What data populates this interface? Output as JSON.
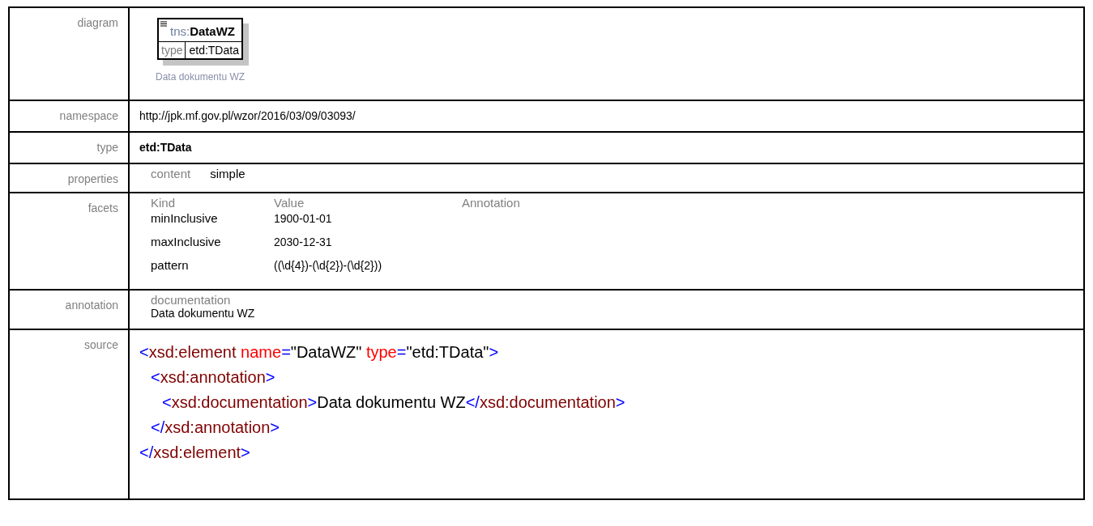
{
  "diagram": {
    "prefix": "tns:",
    "name": "DataWZ",
    "type_label": "type",
    "type_value": "etd:TData",
    "caption": "Data dokumentu WZ"
  },
  "rows": [
    {
      "label": "diagram",
      "kind": "diagram"
    },
    {
      "label": "namespace",
      "kind": "text",
      "value": "http://jpk.mf.gov.pl/wzor/2016/03/09/03093/"
    },
    {
      "label": "type",
      "kind": "bold",
      "value": "etd:TData"
    },
    {
      "label": "properties",
      "kind": "properties"
    },
    {
      "label": "facets",
      "kind": "facets"
    },
    {
      "label": "annotation",
      "kind": "annotation"
    },
    {
      "label": "source",
      "kind": "source"
    }
  ],
  "properties": [
    {
      "name": "content",
      "value": "simple"
    }
  ],
  "facets": {
    "columns": [
      "Kind",
      "Value",
      "Annotation"
    ],
    "rows": [
      {
        "kind": "minInclusive",
        "value": "1900-01-01"
      },
      {
        "kind": "maxInclusive",
        "value": "2030-12-31"
      },
      {
        "kind": "pattern",
        "value": "((\\d{4})-(\\d{2})-(\\d{2}))"
      }
    ]
  },
  "annotation": {
    "label": "documentation",
    "text": "Data dokumentu WZ"
  },
  "source": {
    "lines": [
      {
        "tokens": [
          {
            "kind": "punct",
            "text": "<"
          },
          {
            "kind": "tag",
            "text": "xsd:element"
          },
          {
            "kind": "attr",
            "text": " name"
          },
          {
            "kind": "punct",
            "text": "="
          },
          {
            "kind": "text",
            "text": "\"DataWZ\""
          },
          {
            "kind": "attr",
            "text": " type"
          },
          {
            "kind": "punct",
            "text": "="
          },
          {
            "kind": "text",
            "text": "\"etd:TData\""
          },
          {
            "kind": "punct",
            "text": ">"
          }
        ],
        "children": [
          {
            "tokens": [
              {
                "kind": "punct",
                "text": "<"
              },
              {
                "kind": "tag",
                "text": "xsd:annotation"
              },
              {
                "kind": "punct",
                "text": ">"
              }
            ],
            "children": [
              {
                "tokens": [
                  {
                    "kind": "punct",
                    "text": "<"
                  },
                  {
                    "kind": "tag",
                    "text": "xsd:documentation"
                  },
                  {
                    "kind": "punct",
                    "text": ">"
                  },
                  {
                    "kind": "text",
                    "text": "Data dokumentu WZ"
                  },
                  {
                    "kind": "punct",
                    "text": "</"
                  },
                  {
                    "kind": "tag",
                    "text": "xsd:documentation"
                  },
                  {
                    "kind": "punct",
                    "text": ">"
                  }
                ]
              }
            ]
          },
          {
            "tokens": [
              {
                "kind": "punct",
                "text": "</"
              },
              {
                "kind": "tag",
                "text": "xsd:annotation"
              },
              {
                "kind": "punct",
                "text": ">"
              }
            ]
          }
        ]
      },
      {
        "tokens": [
          {
            "kind": "punct",
            "text": "</"
          },
          {
            "kind": "tag",
            "text": "xsd:element"
          },
          {
            "kind": "punct",
            "text": ">"
          }
        ]
      }
    ]
  }
}
